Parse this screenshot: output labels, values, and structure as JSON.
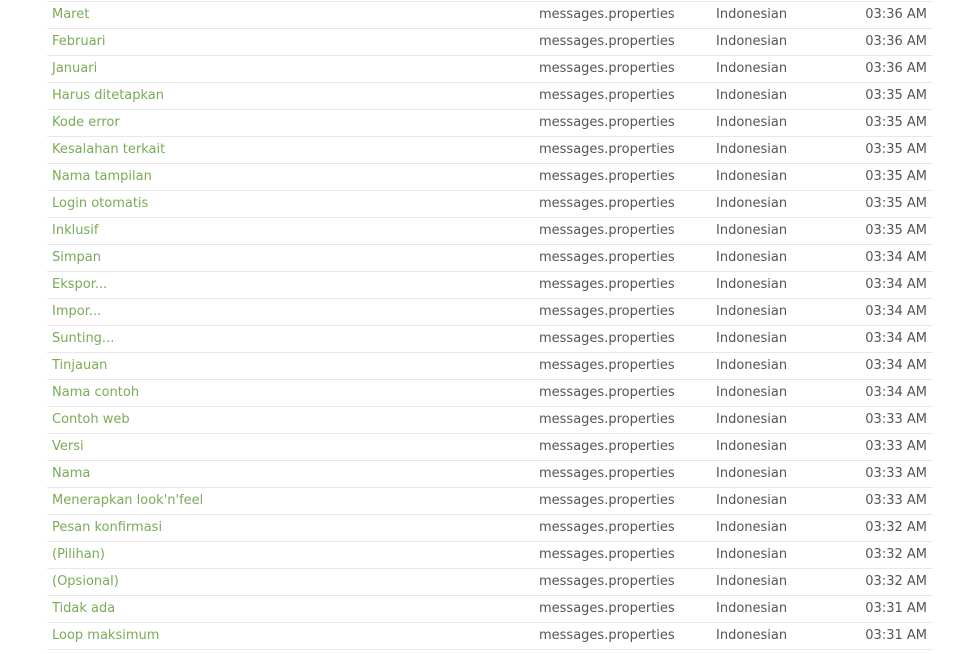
{
  "activity": {
    "rows": [
      {
        "key": "Maret",
        "file": "messages.properties",
        "language": "Indonesian",
        "time": "03:36 AM"
      },
      {
        "key": "Februari",
        "file": "messages.properties",
        "language": "Indonesian",
        "time": "03:36 AM"
      },
      {
        "key": "Januari",
        "file": "messages.properties",
        "language": "Indonesian",
        "time": "03:36 AM"
      },
      {
        "key": "Harus ditetapkan",
        "file": "messages.properties",
        "language": "Indonesian",
        "time": "03:35 AM"
      },
      {
        "key": "Kode error",
        "file": "messages.properties",
        "language": "Indonesian",
        "time": "03:35 AM"
      },
      {
        "key": "Kesalahan terkait",
        "file": "messages.properties",
        "language": "Indonesian",
        "time": "03:35 AM"
      },
      {
        "key": "Nama tampilan",
        "file": "messages.properties",
        "language": "Indonesian",
        "time": "03:35 AM"
      },
      {
        "key": "Login otomatis",
        "file": "messages.properties",
        "language": "Indonesian",
        "time": "03:35 AM"
      },
      {
        "key": "Inklusif",
        "file": "messages.properties",
        "language": "Indonesian",
        "time": "03:35 AM"
      },
      {
        "key": "Simpan",
        "file": "messages.properties",
        "language": "Indonesian",
        "time": "03:34 AM"
      },
      {
        "key": "Ekspor...",
        "file": "messages.properties",
        "language": "Indonesian",
        "time": "03:34 AM"
      },
      {
        "key": "Impor...",
        "file": "messages.properties",
        "language": "Indonesian",
        "time": "03:34 AM"
      },
      {
        "key": "Sunting...",
        "file": "messages.properties",
        "language": "Indonesian",
        "time": "03:34 AM"
      },
      {
        "key": "Tinjauan",
        "file": "messages.properties",
        "language": "Indonesian",
        "time": "03:34 AM"
      },
      {
        "key": "Nama contoh",
        "file": "messages.properties",
        "language": "Indonesian",
        "time": "03:34 AM"
      },
      {
        "key": "Contoh web",
        "file": "messages.properties",
        "language": "Indonesian",
        "time": "03:33 AM"
      },
      {
        "key": "Versi",
        "file": "messages.properties",
        "language": "Indonesian",
        "time": "03:33 AM"
      },
      {
        "key": "Nama",
        "file": "messages.properties",
        "language": "Indonesian",
        "time": "03:33 AM"
      },
      {
        "key": "Menerapkan look'n'feel",
        "file": "messages.properties",
        "language": "Indonesian",
        "time": "03:33 AM"
      },
      {
        "key": "Pesan konfirmasi",
        "file": "messages.properties",
        "language": "Indonesian",
        "time": "03:32 AM"
      },
      {
        "key": "(Pilihan)",
        "file": "messages.properties",
        "language": "Indonesian",
        "time": "03:32 AM"
      },
      {
        "key": "(Opsional)",
        "file": "messages.properties",
        "language": "Indonesian",
        "time": "03:32 AM"
      },
      {
        "key": "Tidak ada",
        "file": "messages.properties",
        "language": "Indonesian",
        "time": "03:31 AM"
      },
      {
        "key": "Loop maksimum",
        "file": "messages.properties",
        "language": "Indonesian",
        "time": "03:31 AM"
      }
    ]
  },
  "colors": {
    "link": "#7aab57",
    "text": "#555555",
    "divider": "#e8e8e8"
  }
}
